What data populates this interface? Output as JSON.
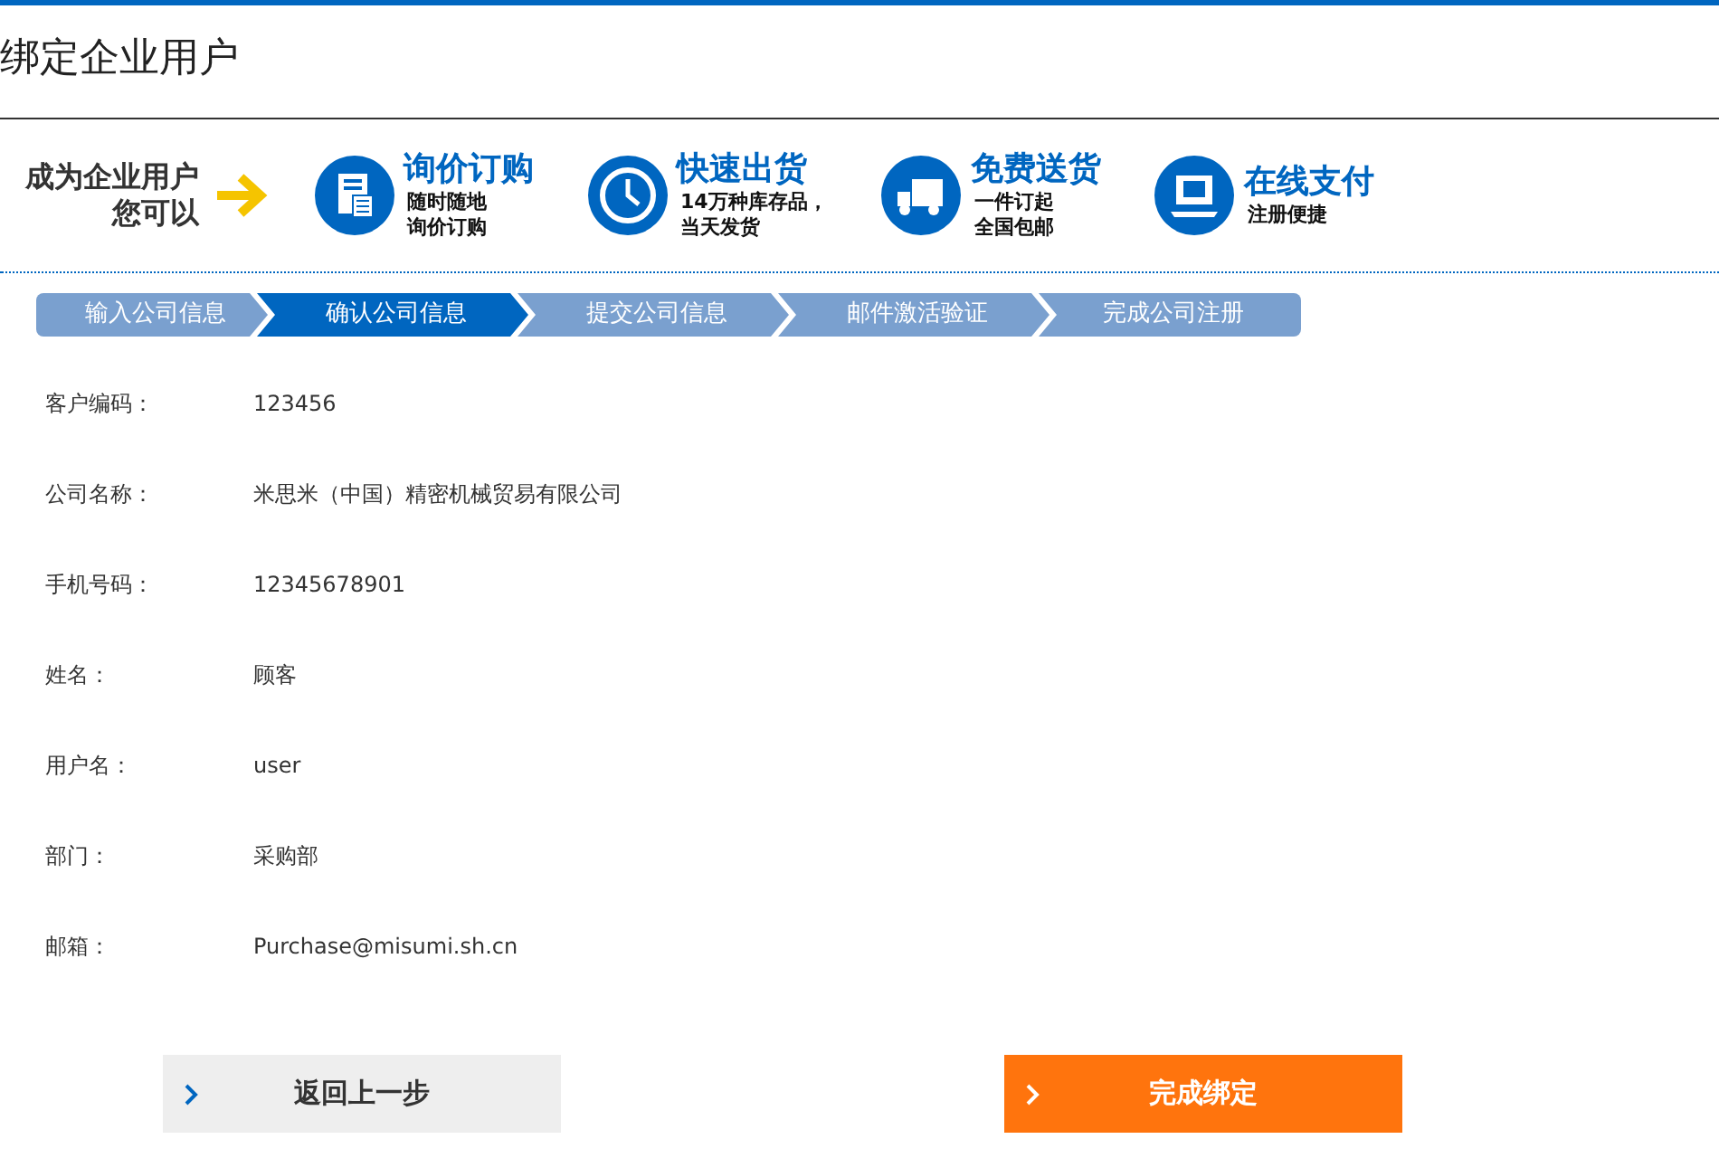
{
  "page": {
    "title": "绑定企业用户"
  },
  "intro": {
    "lines": [
      "成为企业用户",
      "您可以"
    ]
  },
  "features": [
    {
      "kind": "calculator",
      "title": "询价订购",
      "lines": [
        "随时随地",
        "询价订购"
      ]
    },
    {
      "kind": "clock",
      "title": "快速出货",
      "lines": [
        "14万种库存品，",
        "当天发货"
      ]
    },
    {
      "kind": "truck",
      "title": "免费送货",
      "lines": [
        "一件订起",
        "全国包邮"
      ]
    },
    {
      "kind": "monitor",
      "title": "在线支付",
      "lines": [
        "注册便捷"
      ]
    }
  ],
  "steps": [
    {
      "label": "输入公司信息",
      "selected": false
    },
    {
      "label": "确认公司信息",
      "selected": true
    },
    {
      "label": "提交公司信息",
      "selected": false
    },
    {
      "label": "邮件激活验证",
      "selected": false
    },
    {
      "label": "完成公司注册",
      "selected": false
    }
  ],
  "fields": [
    {
      "label": "客户编码：",
      "value": "123456"
    },
    {
      "label": "公司名称：",
      "value": "米思米（中国）精密机械贸易有限公司"
    },
    {
      "label": "手机号码：",
      "value": "12345678901"
    },
    {
      "label": "姓名：",
      "value": "顾客"
    },
    {
      "label": "用户名：",
      "value": "user"
    },
    {
      "label": "部门：",
      "value": "采购部"
    },
    {
      "label": "邮箱：",
      "value": "Purchase@misumi.sh.cn"
    }
  ],
  "buttons": [
    {
      "kind": "back",
      "label": "返回上一步"
    },
    {
      "kind": "primary",
      "label": "完成绑定"
    }
  ]
}
